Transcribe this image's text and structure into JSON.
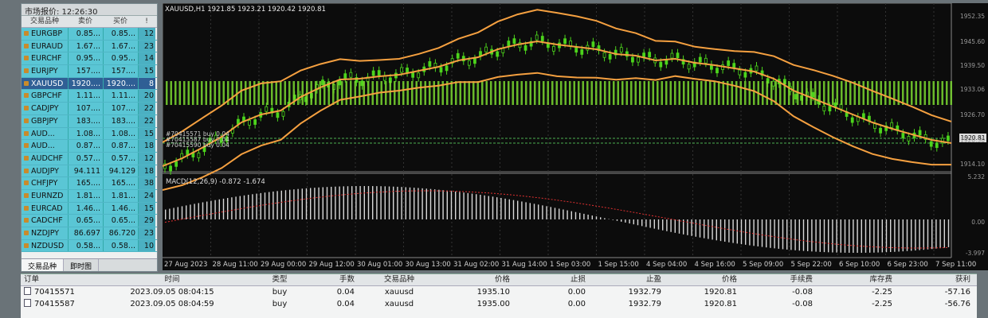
{
  "market_watch": {
    "title": "市场报价: 12:26:30",
    "headers": {
      "symbol": "交易品种",
      "bid": "卖价",
      "ask": "买价",
      "spread": "!"
    },
    "rows": [
      {
        "symbol": "EURGBP",
        "bid": "0.85...",
        "ask": "0.85...",
        "spread": "12"
      },
      {
        "symbol": "EURAUD",
        "bid": "1.67...",
        "ask": "1.67...",
        "spread": "23"
      },
      {
        "symbol": "EURCHF",
        "bid": "0.95...",
        "ask": "0.95...",
        "spread": "14"
      },
      {
        "symbol": "EURJPY",
        "bid": "157....",
        "ask": "157....",
        "spread": "15"
      },
      {
        "symbol": "XAUUSD",
        "bid": "1920....",
        "ask": "1920....",
        "spread": "8"
      },
      {
        "symbol": "GBPCHF",
        "bid": "1.11...",
        "ask": "1.11...",
        "spread": "20"
      },
      {
        "symbol": "CADJPY",
        "bid": "107....",
        "ask": "107....",
        "spread": "22"
      },
      {
        "symbol": "GBPJPY",
        "bid": "183....",
        "ask": "183....",
        "spread": "22"
      },
      {
        "symbol": "AUD...",
        "bid": "1.08...",
        "ask": "1.08...",
        "spread": "15"
      },
      {
        "symbol": "AUD...",
        "bid": "0.87...",
        "ask": "0.87...",
        "spread": "18"
      },
      {
        "symbol": "AUDCHF",
        "bid": "0.57...",
        "ask": "0.57...",
        "spread": "12"
      },
      {
        "symbol": "AUDJPY",
        "bid": "94.111",
        "ask": "94.129",
        "spread": "18"
      },
      {
        "symbol": "CHFJPY",
        "bid": "165....",
        "ask": "165....",
        "spread": "38"
      },
      {
        "symbol": "EURNZD",
        "bid": "1.81...",
        "ask": "1.81...",
        "spread": "24"
      },
      {
        "symbol": "EURCAD",
        "bid": "1.46...",
        "ask": "1.46...",
        "spread": "15"
      },
      {
        "symbol": "CADCHF",
        "bid": "0.65...",
        "ask": "0.65...",
        "spread": "29"
      },
      {
        "symbol": "NZDJPY",
        "bid": "86.697",
        "ask": "86.720",
        "spread": "23"
      },
      {
        "symbol": "NZDUSD",
        "bid": "0.58...",
        "ask": "0.58...",
        "spread": "10"
      }
    ],
    "tabs": [
      "交易品种",
      "即时图"
    ]
  },
  "chart": {
    "title": "XAUUSD,H1  1921.85 1923.21 1920.42 1920.81",
    "macd_label": "MACD(12,26,9) -0.872 -1.674",
    "price_tag": "1920.81",
    "order_labels": [
      "#70415571 buy 0.04",
      "#70415587 buy 0.04",
      "#70415590 buy 0.04"
    ],
    "price_axis": [
      "1952.35",
      "1945.60",
      "1939.50",
      "1933.06",
      "1926.70",
      "1920.30",
      "1914.10"
    ],
    "macd_axis": [
      "5.232",
      "0.00",
      "-3.997"
    ],
    "time_axis": [
      "27 Aug 2023",
      "28 Aug 11:00",
      "29 Aug 00:00",
      "29 Aug 12:00",
      "30 Aug 01:00",
      "30 Aug 13:00",
      "31 Aug 02:00",
      "31 Aug 14:00",
      "1 Sep 03:00",
      "1 Sep 15:00",
      "4 Sep 04:00",
      "4 Sep 16:00",
      "5 Sep 09:00",
      "5 Sep 22:00",
      "6 Sep 10:00",
      "6 Sep 23:00",
      "7 Sep 11:00"
    ],
    "colors": {
      "bg": "#0c0c0c",
      "candle": "#4cd41c",
      "bands": "#f5a040",
      "macd_hist": "#d8d8d8",
      "signal": "#e03030"
    }
  },
  "trade_table": {
    "headers": [
      "订单",
      "时间",
      "类型",
      "手数",
      "交易品种",
      "价格",
      "止损",
      "止盈",
      "价格",
      "手续费",
      "库存费",
      "获利"
    ],
    "rows": [
      [
        "70415571",
        "2023.09.05 08:04:15",
        "buy",
        "0.04",
        "xauusd",
        "1935.10",
        "0.00",
        "1932.79",
        "1920.81",
        "-0.08",
        "-2.25",
        "-57.16"
      ],
      [
        "70415587",
        "2023.09.05 08:04:59",
        "buy",
        "0.04",
        "xauusd",
        "1935.00",
        "0.00",
        "1932.79",
        "1920.81",
        "-0.08",
        "-2.25",
        "-56.76"
      ]
    ]
  }
}
